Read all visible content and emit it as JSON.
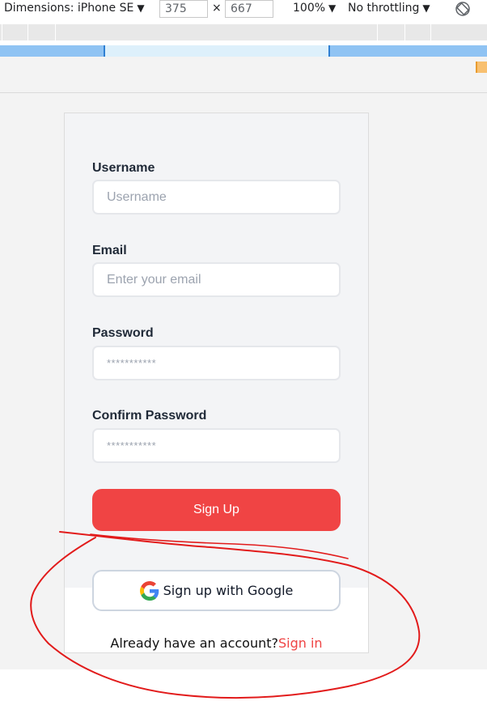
{
  "devtools": {
    "device_label": "Dimensions: iPhone SE",
    "width_value": "375",
    "times_sign": "×",
    "height_value": "667",
    "zoom": "100%",
    "throttling": "No throttling",
    "caret": "▼"
  },
  "form": {
    "username_label": "Username",
    "username_placeholder": "Username",
    "email_label": "Email",
    "email_placeholder": "Enter your email",
    "password_label": "Password",
    "password_placeholder": "***********",
    "confirm_label": "Confirm Password",
    "confirm_placeholder": "***********",
    "signup_button": "Sign Up",
    "google_button": "Sign up with Google",
    "signin_prompt": "Already have an account?",
    "signin_link": "Sign in"
  },
  "colors": {
    "primary_red": "#f04444",
    "link_red": "#ef4444",
    "annotation_red": "#e21b1b"
  },
  "icons": {
    "google": "google-g-icon",
    "rotate": "rotate-device-icon"
  }
}
